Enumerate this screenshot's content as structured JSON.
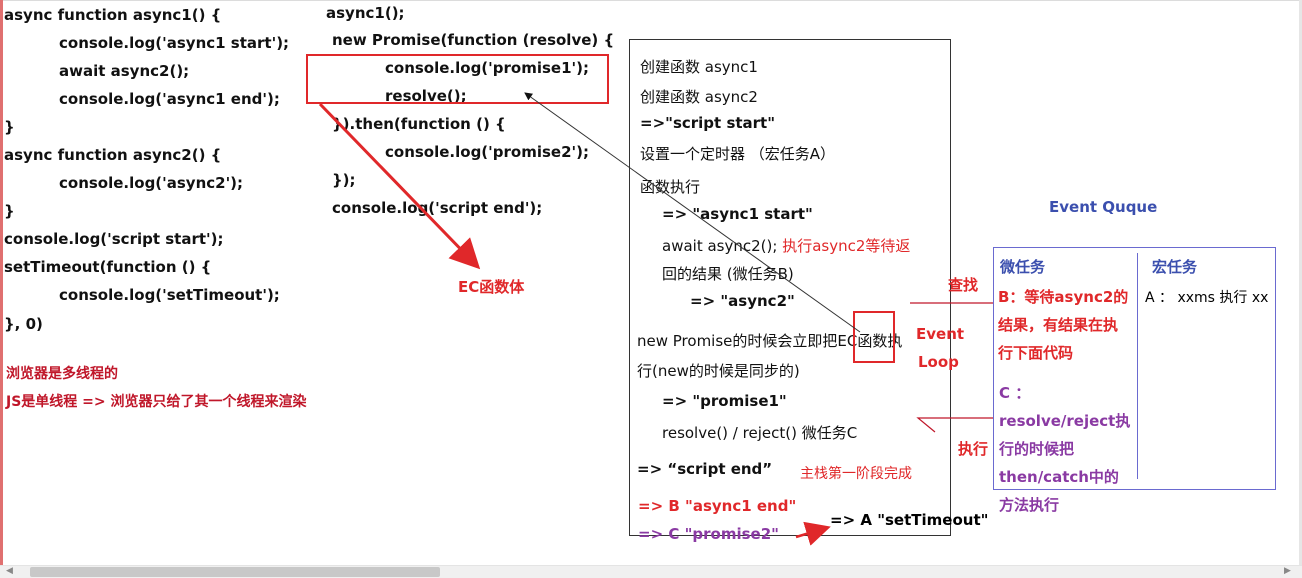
{
  "left_code": [
    "async function async1() {",
    "console.log('async1 start');",
    "await async2();",
    "console.log('async1 end');",
    "}",
    "async function async2() {",
    "console.log('async2');",
    "}",
    "console.log('script start');",
    "setTimeout(function () {",
    "console.log('setTimeout');",
    "}, 0)"
  ],
  "middle_code": [
    "async1();",
    "new Promise(function (resolve) {",
    "console.log('promise1');",
    "resolve();",
    "}).then(function () {",
    "console.log('promise2');",
    "});",
    "console.log('script end');"
  ],
  "notes": {
    "browser_multithread": "浏览器是多线程的",
    "js_single_thread": "JS是单线程 => 浏览器只给了其一个线程来渲染",
    "ec_function_body": "EC函数体"
  },
  "exec_panel": {
    "create_async1": "创建函数   async1",
    "create_async2": "创建函数   async2",
    "script_start": "=>\"script start\"",
    "set_timer": "设置一个定时器  （宏任务A）",
    "func_exec": "函数执行",
    "async1_start": "=> \"async1 start\"",
    "await_prefix": "await async2();",
    "await_note_1": "执行async2等待返",
    "await_note_2": "回的结果  (微任务B)",
    "async2_out": "=> \"async2\"",
    "new_promise_1": "new Promise的时候会立即把EC函数执",
    "new_promise_2": "行(new的时候是同步的)",
    "promise1_out": "=> \"promise1\"",
    "resolve_line": "resolve()  / reject()  微任务C",
    "script_end": "=>  “script end”",
    "main_stack_done": "主栈第一阶段完成",
    "b_async1_end": "=> B \"async1 end\"",
    "c_promise2": "=> C  \"promise2\"",
    "a_settimeout": "=> A   \"setTimeout\""
  },
  "event_loop": {
    "label_1": "Event",
    "label_2": "Loop",
    "find": "查找",
    "execute": "执行"
  },
  "event_queue": {
    "title": "Event Ququе",
    "micro_header": "微任务",
    "macro_header": "宏任务",
    "micro_b_1": "B：等待async2的",
    "micro_b_2": "结果，有结果在执",
    "micro_b_3": "行下面代码",
    "micro_c_1": "C  ：",
    "micro_c_2": "resolve/reject执",
    "micro_c_3": "行的时候把",
    "micro_c_4": "then/catch中的",
    "micro_c_5": "方法执行",
    "macro_a": "A ： xxms 执行 xx"
  },
  "colors": {
    "red": "#e0282a",
    "purple": "#8a3aa3",
    "blue": "#3b4fae",
    "dark_red": "#c0172a"
  }
}
